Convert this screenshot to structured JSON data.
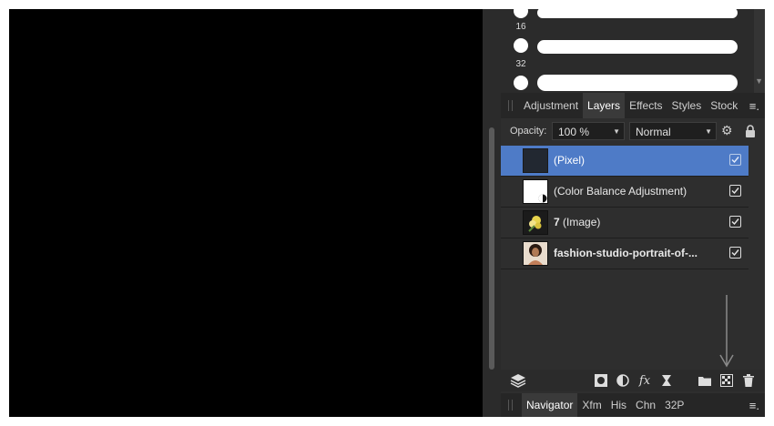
{
  "brushes": {
    "sizes": [
      "16",
      "32"
    ]
  },
  "tabs_top": [
    {
      "label": "Adjustment",
      "active": false
    },
    {
      "label": "Layers",
      "active": true
    },
    {
      "label": "Effects",
      "active": false
    },
    {
      "label": "Styles",
      "active": false
    },
    {
      "label": "Stock",
      "active": false
    }
  ],
  "layers_panel": {
    "opacity_label": "Opacity:",
    "opacity_value": "100 %",
    "blend_mode": "Normal"
  },
  "layers": [
    {
      "prefix": "",
      "name": "(Pixel)",
      "selected": true,
      "checked": true,
      "thumb": "dark"
    },
    {
      "prefix": "",
      "name": "(Color Balance Adjustment)",
      "selected": false,
      "checked": true,
      "thumb": "white-adjust"
    },
    {
      "prefix": "7",
      "name": " (Image)",
      "selected": false,
      "checked": true,
      "thumb": "flower"
    },
    {
      "prefix": "",
      "name": "fashion-studio-portrait-of-...",
      "selected": false,
      "checked": true,
      "thumb": "portrait",
      "bold": true
    }
  ],
  "tabs_bottom": [
    {
      "label": "Navigator",
      "active": true
    },
    {
      "label": "Xfm",
      "active": false
    },
    {
      "label": "His",
      "active": false
    },
    {
      "label": "Chn",
      "active": false
    },
    {
      "label": "32P",
      "active": false
    }
  ],
  "icons": {
    "menu": "hamburger-icon",
    "settings": "gear-icon",
    "lock": "lock-icon"
  }
}
